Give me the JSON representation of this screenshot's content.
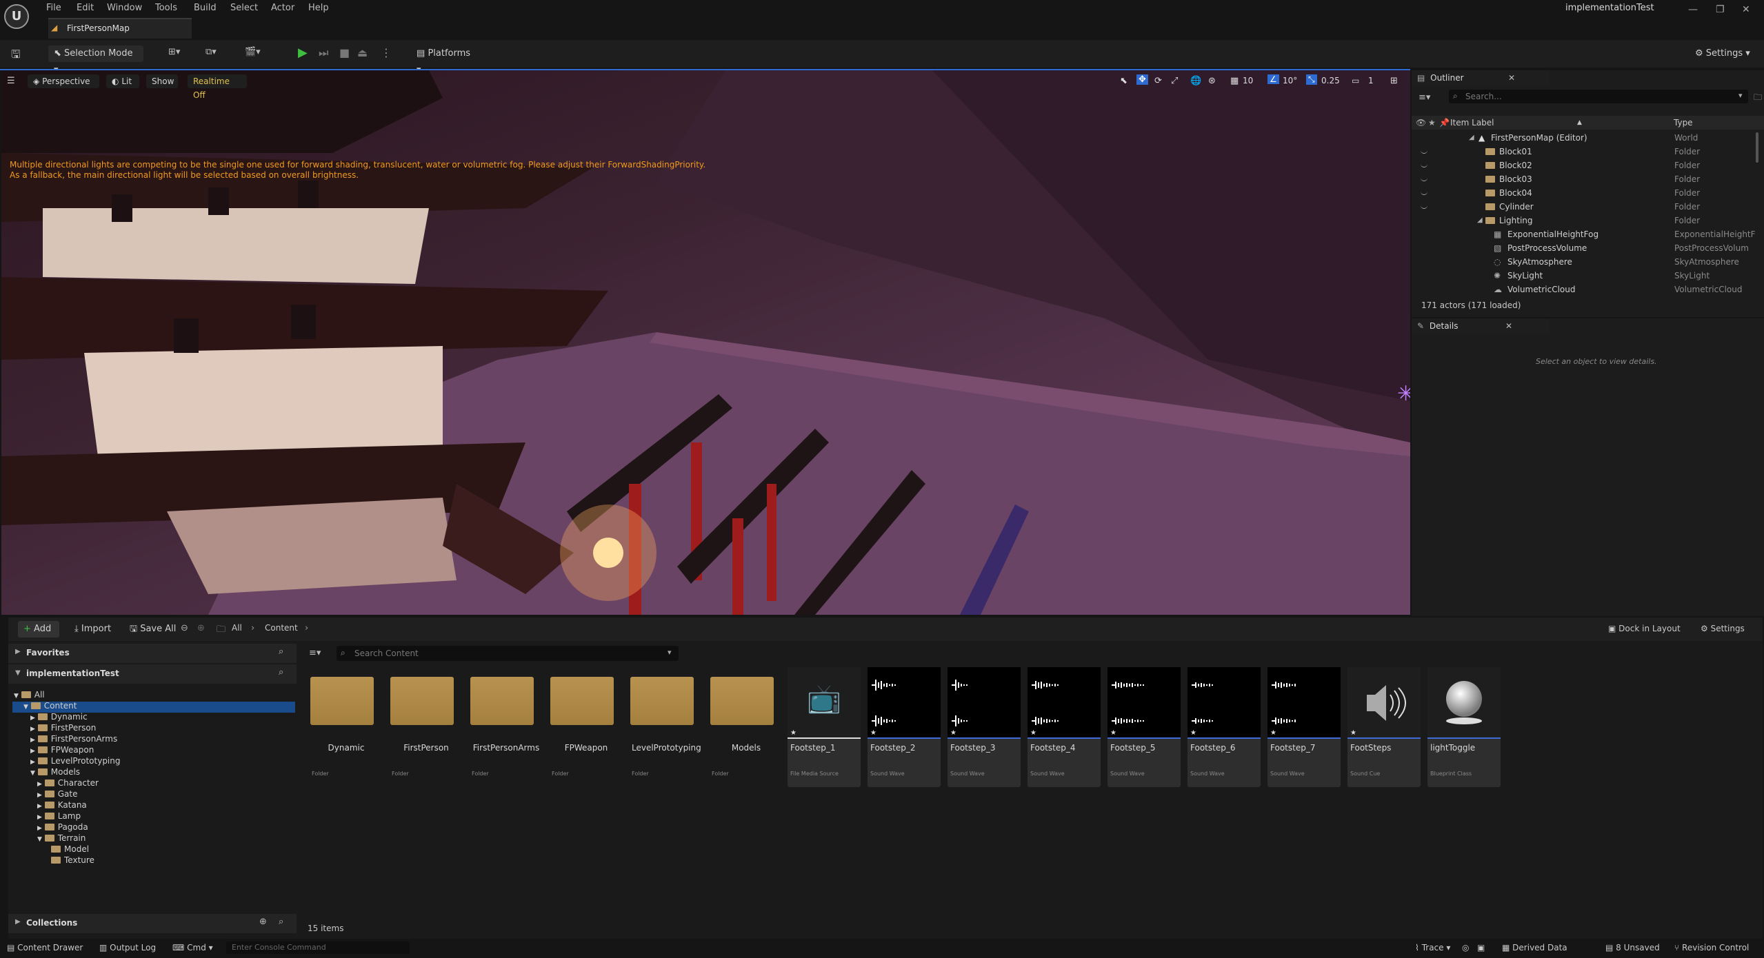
{
  "menu": [
    "File",
    "Edit",
    "Window",
    "Tools",
    "Build",
    "Select",
    "Actor",
    "Help"
  ],
  "project_name": "implementationTest",
  "tab_title": "FirstPersonMap",
  "toolbar": {
    "selection_mode": "Selection Mode",
    "platforms": "Platforms",
    "settings": "Settings"
  },
  "viewport": {
    "perspective": "Perspective",
    "lit": "Lit",
    "show": "Show",
    "realtime": "Realtime Off",
    "grid_snap": "10",
    "rot_snap": "10°",
    "scale_snap": "0.25",
    "camera_speed": "1",
    "warning_line1": "Multiple directional lights are competing to be the single one used for forward shading, translucent, water or volumetric fog. Please adjust their ForwardShadingPriority.",
    "warning_line2": "As a fallback, the main directional light will be selected based on overall brightness."
  },
  "outliner": {
    "title": "Outliner",
    "search_placeholder": "Search...",
    "col_label": "Item Label",
    "col_type": "Type",
    "rows": [
      {
        "label": "FirstPersonMap (Editor)",
        "type": "World"
      },
      {
        "label": "Block01",
        "type": "Folder"
      },
      {
        "label": "Block02",
        "type": "Folder"
      },
      {
        "label": "Block03",
        "type": "Folder"
      },
      {
        "label": "Block04",
        "type": "Folder"
      },
      {
        "label": "Cylinder",
        "type": "Folder"
      },
      {
        "label": "Lighting",
        "type": "Folder"
      },
      {
        "label": "ExponentialHeightFog",
        "type": "ExponentialHeightF"
      },
      {
        "label": "PostProcessVolume",
        "type": "PostProcessVolum"
      },
      {
        "label": "SkyAtmosphere",
        "type": "SkyAtmosphere"
      },
      {
        "label": "SkyLight",
        "type": "SkyLight"
      },
      {
        "label": "VolumetricCloud",
        "type": "VolumetricCloud"
      }
    ],
    "count": "171 actors (171 loaded)"
  },
  "details": {
    "title": "Details",
    "empty": "Select an object to view details."
  },
  "content_browser": {
    "add": "Add",
    "import": "Import",
    "save_all": "Save All",
    "path": [
      "All",
      "Content"
    ],
    "dock": "Dock in Layout",
    "settings": "Settings",
    "favorites": "Favorites",
    "project": "implementationTest",
    "search_placeholder": "Search Content",
    "tree": [
      "All",
      "Content",
      "Dynamic",
      "FirstPerson",
      "FirstPersonArms",
      "FPWeapon",
      "LevelPrototyping",
      "Models",
      "Character",
      "Gate",
      "Katana",
      "Lamp",
      "Pagoda",
      "Terrain",
      "Model",
      "Texture"
    ],
    "collections": "Collections",
    "item_count": "15 items",
    "assets": [
      {
        "name": "Dynamic",
        "type": "Folder"
      },
      {
        "name": "FirstPerson",
        "type": "Folder"
      },
      {
        "name": "FirstPersonArms",
        "type": "Folder"
      },
      {
        "name": "FPWeapon",
        "type": "Folder"
      },
      {
        "name": "LevelPrototyping",
        "type": "Folder"
      },
      {
        "name": "Models",
        "type": "Folder"
      },
      {
        "name": "Footstep_1",
        "type": "File Media Source"
      },
      {
        "name": "Footstep_2",
        "type": "Sound Wave"
      },
      {
        "name": "Footstep_3",
        "type": "Sound Wave"
      },
      {
        "name": "Footstep_4",
        "type": "Sound Wave"
      },
      {
        "name": "Footstep_5",
        "type": "Sound Wave"
      },
      {
        "name": "Footstep_6",
        "type": "Sound Wave"
      },
      {
        "name": "Footstep_7",
        "type": "Sound Wave"
      },
      {
        "name": "FootSteps",
        "type": "Sound Cue"
      },
      {
        "name": "lightToggle",
        "type": "Blueprint Class"
      }
    ]
  },
  "statusbar": {
    "content_drawer": "Content Drawer",
    "output_log": "Output Log",
    "cmd": "Cmd",
    "console_placeholder": "Enter Console Command",
    "trace": "Trace",
    "derived_data": "Derived Data",
    "unsaved": "8 Unsaved",
    "revision": "Revision Control"
  }
}
